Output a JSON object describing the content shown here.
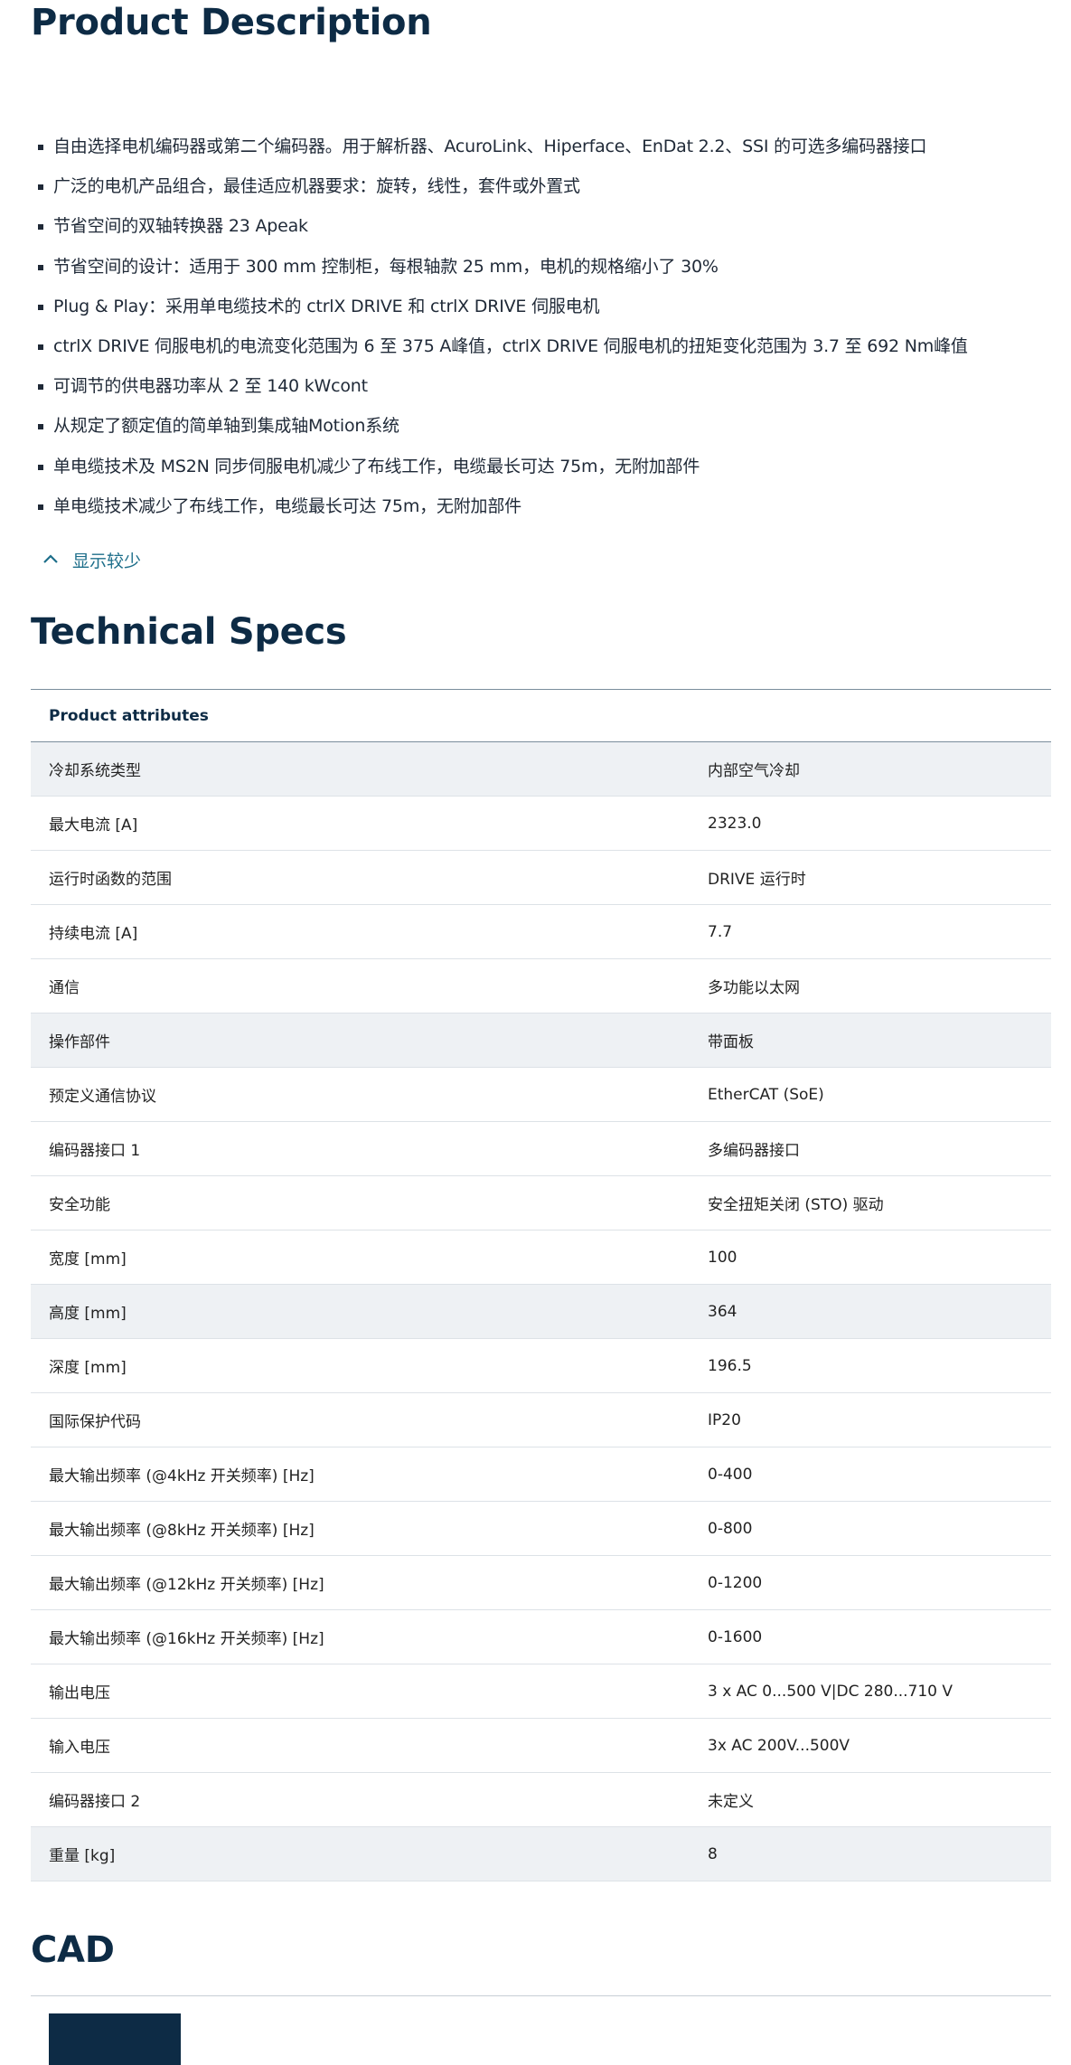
{
  "description": {
    "title": "Product Description",
    "bullets": [
      "自由选择电机编码器或第二个编码器。用于解析器、AcuroLink、Hiperface、EnDat 2.2、SSI 的可选多编码器接口",
      "广泛的电机产品组合，最佳适应机器要求：旋转，线性，套件或外置式",
      "节省空间的双轴转换器 23 Apeak",
      "节省空间的设计：适用于 300 mm 控制柜，每根轴款 25 mm，电机的规格缩小了 30%",
      "Plug & Play：采用单电缆技术的 ctrlX DRIVE 和 ctrlX DRIVE 伺服电机",
      "ctrlX DRIVE 伺服电机的电流变化范围为 6 至 375 A峰值，ctrlX DRIVE 伺服电机的扭矩变化范围为 3.7 至 692 Nm峰值",
      "可调节的供电器功率从 2 至 140 kWcont",
      "从规定了额定值的简单轴到集成轴Motion系统",
      "单电缆技术及 MS2N 同步伺服电机减少了布线工作，电缆最长可达 75m，无附加部件",
      "单电缆技术减少了布线工作，电缆最长可达 75m，无附加部件"
    ],
    "show_less_label": "显示较少"
  },
  "specs": {
    "title": "Technical Specs",
    "header": "Product attributes",
    "rows": [
      {
        "key": "冷却系统类型",
        "value": "内部空气冷却",
        "shaded": true
      },
      {
        "key": "最大电流 [A]",
        "value": "2323.0",
        "shaded": false
      },
      {
        "key": "运行时函数的范围",
        "value": "DRIVE 运行时",
        "shaded": false
      },
      {
        "key": "持续电流 [A]",
        "value": "7.7",
        "shaded": false
      },
      {
        "key": "通信",
        "value": "多功能以太网",
        "shaded": false
      },
      {
        "key": "操作部件",
        "value": "带面板",
        "shaded": true
      },
      {
        "key": "预定义通信协议",
        "value": "EtherCAT (SoE)",
        "shaded": false
      },
      {
        "key": "编码器接口 1",
        "value": "多编码器接口",
        "shaded": false
      },
      {
        "key": "安全功能",
        "value": "安全扭矩关闭 (STO) 驱动",
        "shaded": false
      },
      {
        "key": "宽度 [mm]",
        "value": "100",
        "shaded": false
      },
      {
        "key": "高度 [mm]",
        "value": "364",
        "shaded": true
      },
      {
        "key": "深度 [mm]",
        "value": "196.5",
        "shaded": false
      },
      {
        "key": "国际保护代码",
        "value": "IP20",
        "shaded": false
      },
      {
        "key": "最大输出频率 (@4kHz 开关频率) [Hz]",
        "value": "0-400",
        "shaded": false
      },
      {
        "key": "最大输出频率 (@8kHz 开关频率) [Hz]",
        "value": "0-800",
        "shaded": false
      },
      {
        "key": "最大输出频率 (@12kHz 开关频率) [Hz]",
        "value": "0-1200",
        "shaded": false
      },
      {
        "key": "最大输出频率 (@16kHz 开关频率) [Hz]",
        "value": "0-1600",
        "shaded": false
      },
      {
        "key": "输出电压",
        "value": "3 x AC 0...500 V|DC 280...710 V",
        "shaded": false
      },
      {
        "key": "输入电压",
        "value": "3x AC 200V...500V",
        "shaded": false
      },
      {
        "key": "编码器接口 2",
        "value": "未定义",
        "shaded": false
      },
      {
        "key": "重量 [kg]",
        "value": "8",
        "shaded": true
      }
    ]
  },
  "cad": {
    "title": "CAD"
  },
  "colors": {
    "heading": "#0d2b45",
    "link": "#1d6e8a",
    "row_shade": "#eef1f4"
  },
  "icons": {
    "show_less": "chevron-up-icon"
  }
}
